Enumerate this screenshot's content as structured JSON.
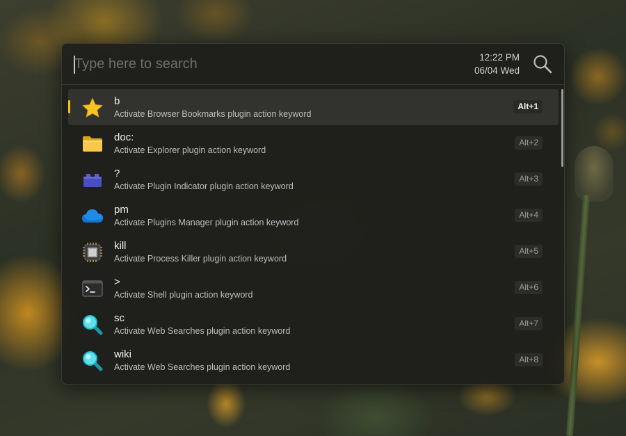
{
  "search": {
    "placeholder": "Type here to search",
    "value": ""
  },
  "clock": {
    "time": "12:22 PM",
    "date": "06/04 Wed"
  },
  "results": [
    {
      "title": "b",
      "subtitle": "Activate Browser Bookmarks plugin action keyword",
      "hotkey": "Alt+1",
      "icon": "star-icon",
      "selected": true
    },
    {
      "title": "doc:",
      "subtitle": "Activate Explorer plugin action keyword",
      "hotkey": "Alt+2",
      "icon": "folder-icon",
      "selected": false
    },
    {
      "title": "?",
      "subtitle": "Activate Plugin Indicator plugin action keyword",
      "hotkey": "Alt+3",
      "icon": "plugin-block-icon",
      "selected": false
    },
    {
      "title": "pm",
      "subtitle": "Activate Plugins Manager plugin action keyword",
      "hotkey": "Alt+4",
      "icon": "cloud-icon",
      "selected": false
    },
    {
      "title": "kill",
      "subtitle": "Activate Process Killer plugin action keyword",
      "hotkey": "Alt+5",
      "icon": "cpu-chip-icon",
      "selected": false
    },
    {
      "title": ">",
      "subtitle": "Activate Shell plugin action keyword",
      "hotkey": "Alt+6",
      "icon": "terminal-icon",
      "selected": false
    },
    {
      "title": "sc",
      "subtitle": "Activate Web Searches plugin action keyword",
      "hotkey": "Alt+7",
      "icon": "magnifier-icon",
      "selected": false
    },
    {
      "title": "wiki",
      "subtitle": "Activate Web Searches plugin action keyword",
      "hotkey": "Alt+8",
      "icon": "magnifier-icon",
      "selected": false
    }
  ],
  "colors": {
    "accent": "#f3c21c",
    "window_bg": "#1e1e1b",
    "text_primary": "#f0f0f0",
    "text_secondary": "#bdbdbd"
  }
}
